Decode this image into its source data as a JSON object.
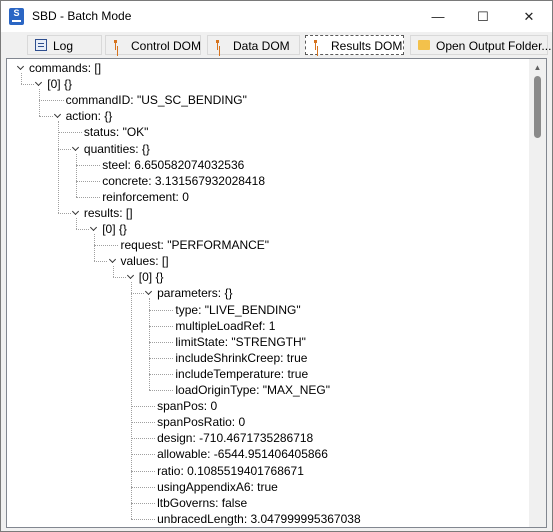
{
  "window": {
    "title": "SBD - Batch Mode",
    "icon_letter": "S"
  },
  "tabs": [
    {
      "label": "Log"
    },
    {
      "label": "Control DOM"
    },
    {
      "label": "Data DOM"
    },
    {
      "label": "Results DOM"
    }
  ],
  "toolbar": {
    "open_output_label": "Open Output Folder..."
  },
  "tree": [
    "commands: []",
    "[0] {}",
    "commandID: \"US_SC_BENDING\"",
    "action: {}",
    "status: \"OK\"",
    "quantities: {}",
    "steel: 6.650582074032536",
    "concrete: 3.131567932028418",
    "reinforcement: 0",
    "results: []",
    "[0] {}",
    "request: \"PERFORMANCE\"",
    "values: []",
    "[0] {}",
    "parameters: {}",
    "type: \"LIVE_BENDING\"",
    "multipleLoadRef: 1",
    "limitState: \"STRENGTH\"",
    "includeShrinkCreep: true",
    "includeTemperature: true",
    "loadOriginType: \"MAX_NEG\"",
    "spanPos: 0",
    "spanPosRatio: 0",
    "design: -710.4671735286718",
    "allowable: -6544.951406405866",
    "ratio: 0.1085519401768671",
    "usingAppendixA6: true",
    "ltbGoverns: false",
    "unbracedLength: 3.047999995367038"
  ]
}
